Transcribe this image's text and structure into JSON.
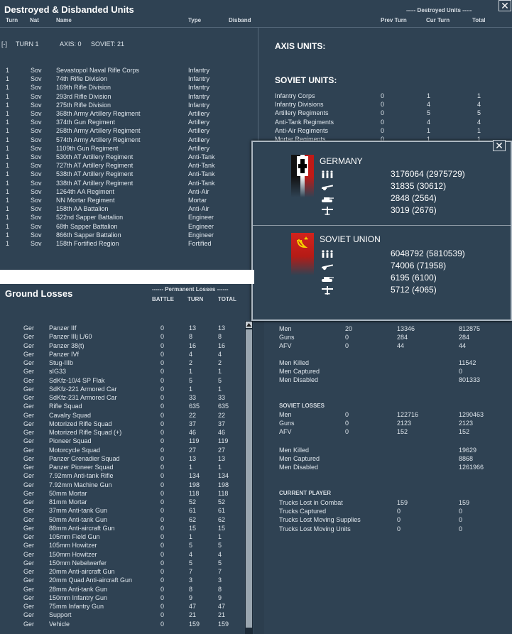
{
  "destroyed": {
    "title": "Destroyed & Disbanded Units",
    "subheader": "----- Destroyed Units -----",
    "columns": {
      "turn": "Turn",
      "nat": "Nat",
      "name": "Name",
      "type": "Type",
      "disband": "Disband",
      "prev_turn": "Prev Turn",
      "cur_turn": "Cur Turn",
      "total": "Total"
    },
    "expand": "[-]",
    "turn_label": "TURN 1",
    "axis_label": "AXIS: 0",
    "soviet_label": "SOVIET: 21",
    "rows": [
      [
        "1",
        "Sov",
        "Sevastopol Naval Rifle Corps",
        "Infantry"
      ],
      [
        "1",
        "Sov",
        "74th Rifle Division",
        "Infantry"
      ],
      [
        "1",
        "Sov",
        "169th Rifle Division",
        "Infantry"
      ],
      [
        "1",
        "Sov",
        "293rd Rifle Division",
        "Infantry"
      ],
      [
        "1",
        "Sov",
        "275th Rifle Division",
        "Infantry"
      ],
      [
        "1",
        "Sov",
        "368th Army Artillery Regiment",
        "Artillery"
      ],
      [
        "1",
        "Sov",
        "374th Gun Regiment",
        "Artillery"
      ],
      [
        "1",
        "Sov",
        "268th Army Artillery Regiment",
        "Artillery"
      ],
      [
        "1",
        "Sov",
        "574th Army Artillery Regiment",
        "Artillery"
      ],
      [
        "1",
        "Sov",
        "1109th Gun Regiment",
        "Artillery"
      ],
      [
        "1",
        "Sov",
        "530th AT Artillery Regiment",
        "Anti-Tank"
      ],
      [
        "1",
        "Sov",
        "727th AT Artillery Regiment",
        "Anti-Tank"
      ],
      [
        "1",
        "Sov",
        "538th AT Artillery Regiment",
        "Anti-Tank"
      ],
      [
        "1",
        "Sov",
        "338th AT Artillery Regiment",
        "Anti-Tank"
      ],
      [
        "1",
        "Sov",
        "1264th AA Regiment",
        "Anti-Air"
      ],
      [
        "1",
        "Sov",
        "NN Mortar Regiment",
        "Mortar"
      ],
      [
        "1",
        "Sov",
        "158th AA Battalion",
        "Anti-Air"
      ],
      [
        "1",
        "Sov",
        "522nd Sapper Battalion",
        "Engineer"
      ],
      [
        "1",
        "Sov",
        "68th Sapper Battalion",
        "Engineer"
      ],
      [
        "1",
        "Sov",
        "866th Sapper Battalion",
        "Engineer"
      ],
      [
        "1",
        "Sov",
        "158th Fortified Region",
        "Fortified"
      ]
    ],
    "axis_units_title": "AXIS UNITS:",
    "soviet_units_title": "SOVIET UNITS:",
    "soviet_units": [
      [
        "Infantry Corps",
        "0",
        "1",
        "1"
      ],
      [
        "Infantry Divisions",
        "0",
        "4",
        "4"
      ],
      [
        "Artillery Regiments",
        "0",
        "5",
        "5"
      ],
      [
        "Anti-Tank Regiments",
        "0",
        "4",
        "4"
      ],
      [
        "Anti-Air Regiments",
        "0",
        "1",
        "1"
      ],
      [
        "Mortar Regiments",
        "0",
        "1",
        "1"
      ]
    ]
  },
  "ground": {
    "title": "Ground Losses",
    "subheader": "------ Permanent Losses ------",
    "columns": {
      "battle": "BATTLE",
      "turn": "TURN",
      "total": "TOTAL"
    },
    "rows": [
      [
        "Ger",
        "Panzer IIf",
        "0",
        "13",
        "13"
      ],
      [
        "Ger",
        "Panzer IIIj L/60",
        "0",
        "8",
        "8"
      ],
      [
        "Ger",
        "Panzer 38(t)",
        "0",
        "16",
        "16"
      ],
      [
        "Ger",
        "Panzer IVf",
        "0",
        "4",
        "4"
      ],
      [
        "Ger",
        "Stug-IIIb",
        "0",
        "2",
        "2"
      ],
      [
        "Ger",
        "sIG33",
        "0",
        "1",
        "1"
      ],
      [
        "Ger",
        "SdKfz-10/4 SP Flak",
        "0",
        "5",
        "5"
      ],
      [
        "Ger",
        "SdKfz-221 Armored Car",
        "0",
        "1",
        "1"
      ],
      [
        "Ger",
        "SdKfz-231 Armored Car",
        "0",
        "33",
        "33"
      ],
      [
        "Ger",
        "Rifle Squad",
        "0",
        "635",
        "635"
      ],
      [
        "Ger",
        "Cavalry Squad",
        "0",
        "22",
        "22"
      ],
      [
        "Ger",
        "Motorized Rifle Squad",
        "0",
        "37",
        "37"
      ],
      [
        "Ger",
        "Motorized Rifle Squad (+)",
        "0",
        "46",
        "46"
      ],
      [
        "Ger",
        "Pioneer Squad",
        "0",
        "119",
        "119"
      ],
      [
        "Ger",
        "Motorcycle Squad",
        "0",
        "27",
        "27"
      ],
      [
        "Ger",
        "Panzer Grenadier Squad",
        "0",
        "13",
        "13"
      ],
      [
        "Ger",
        "Panzer Pioneer Squad",
        "0",
        "1",
        "1"
      ],
      [
        "Ger",
        "7.92mm Anti-tank Rifle",
        "0",
        "134",
        "134"
      ],
      [
        "Ger",
        "7.92mm Machine Gun",
        "0",
        "198",
        "198"
      ],
      [
        "Ger",
        "50mm Mortar",
        "0",
        "118",
        "118"
      ],
      [
        "Ger",
        "81mm Mortar",
        "0",
        "52",
        "52"
      ],
      [
        "Ger",
        "37mm Anti-tank Gun",
        "0",
        "61",
        "61"
      ],
      [
        "Ger",
        "50mm Anti-tank Gun",
        "0",
        "62",
        "62"
      ],
      [
        "Ger",
        "88mm Anti-aircraft Gun",
        "0",
        "15",
        "15"
      ],
      [
        "Ger",
        "105mm Field Gun",
        "0",
        "1",
        "1"
      ],
      [
        "Ger",
        "105mm Howitzer",
        "0",
        "5",
        "5"
      ],
      [
        "Ger",
        "150mm Howitzer",
        "0",
        "4",
        "4"
      ],
      [
        "Ger",
        "150mm Nebelwerfer",
        "0",
        "5",
        "5"
      ],
      [
        "Ger",
        "20mm Anti-aircraft Gun",
        "0",
        "7",
        "7"
      ],
      [
        "Ger",
        "20mm Quad Anti-aircraft Gun",
        "0",
        "3",
        "3"
      ],
      [
        "Ger",
        "28mm Anti-tank Gun",
        "0",
        "8",
        "8"
      ],
      [
        "Ger",
        "150mm Infantry Gun",
        "0",
        "9",
        "9"
      ],
      [
        "Ger",
        "75mm Infantry Gun",
        "0",
        "47",
        "47"
      ],
      [
        "Ger",
        "Support",
        "0",
        "21",
        "21"
      ],
      [
        "Ger",
        "Vehicle",
        "0",
        "159",
        "159"
      ]
    ]
  },
  "summary": {
    "axis_rows": [
      [
        "Men",
        "20",
        "13346",
        "812875"
      ],
      [
        "Guns",
        "0",
        "284",
        "284"
      ],
      [
        "AFV",
        "0",
        "44",
        "44"
      ]
    ],
    "axis_casualties": [
      [
        "Men Killed",
        "11542"
      ],
      [
        "Men Captured",
        "0"
      ],
      [
        "Men Disabled",
        "801333"
      ]
    ],
    "soviet_title": "SOVIET LOSSES",
    "soviet_rows": [
      [
        "Men",
        "0",
        "122716",
        "1290463"
      ],
      [
        "Guns",
        "0",
        "2123",
        "2123"
      ],
      [
        "AFV",
        "0",
        "152",
        "152"
      ]
    ],
    "soviet_casualties": [
      [
        "Men Killed",
        "19629"
      ],
      [
        "Men Captured",
        "8868"
      ],
      [
        "Men Disabled",
        "1261966"
      ]
    ],
    "player_title": "CURRENT PLAYER",
    "trucks": [
      [
        "Trucks Lost in Combat",
        "159",
        "159"
      ],
      [
        "Trucks Captured",
        "0",
        "0"
      ],
      [
        "Trucks Lost Moving Supplies",
        "0",
        "0"
      ],
      [
        "Trucks Lost Moving Units",
        "0",
        "0"
      ]
    ]
  },
  "popup": {
    "germany": {
      "name": "GERMANY",
      "men": "3176064 (2975729)",
      "guns": "31835 (30612)",
      "afv": "2848 (2564)",
      "air": "3019 (2676)"
    },
    "soviet": {
      "name": "SOVIET UNION",
      "men": "6048792 (5810539)",
      "guns": "74006 (71958)",
      "afv": "6195 (6100)",
      "air": "5712 (4065)"
    }
  },
  "close_glyph": "✕",
  "icons": [
    "close-icon",
    "men-icon",
    "gun-icon",
    "tank-icon",
    "aircraft-icon",
    "balkenkreuz-icon",
    "hammer-sickle-icon",
    "scroll-up-arrow-icon"
  ],
  "colors": {
    "panel_bg": "#2e4152",
    "germany_flag": "#111111",
    "soviet_flag": "#c8201c"
  }
}
